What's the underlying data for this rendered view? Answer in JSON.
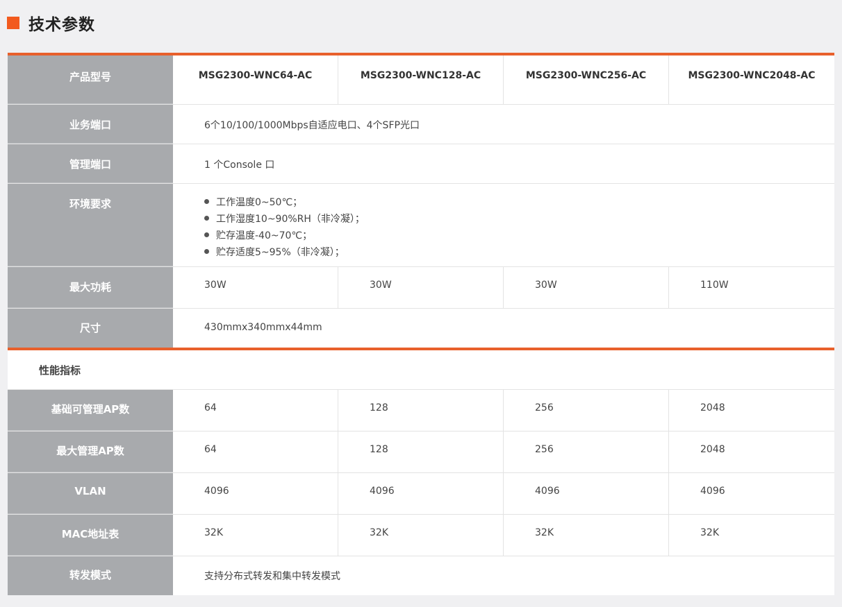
{
  "section_title": "技术参数",
  "models": [
    "MSG2300-WNC64-AC",
    "MSG2300-WNC128-AC",
    "MSG2300-WNC256-AC",
    "MSG2300-WNC2048-AC"
  ],
  "labels": {
    "model": "产品型号",
    "ports": "业务端口",
    "mgmt": "管理端口",
    "env": "环境要求",
    "power": "最大功耗",
    "size": "尺寸",
    "base_ap": "基础可管理AP数",
    "max_ap": "最大管理AP数",
    "vlan": "VLAN",
    "mac": "MAC地址表",
    "forward": "转发模式"
  },
  "values": {
    "ports": "6个10/100/1000Mbps自适应电口、4个SFP光口",
    "mgmt": "1 个Console 口",
    "env": [
      "工作温度0~50℃；",
      "工作湿度10~90%RH（非冷凝）；",
      "贮存温度-40~70℃；",
      "贮存适度5~95%（非冷凝）；"
    ],
    "power": [
      "30W",
      "30W",
      "30W",
      "110W"
    ],
    "size": "430mmx340mmx44mm",
    "base_ap": [
      "64",
      "128",
      "256",
      "2048"
    ],
    "max_ap": [
      "64",
      "128",
      "256",
      "2048"
    ],
    "vlan": [
      "4096",
      "4096",
      "4096",
      "4096"
    ],
    "mac": [
      "32K",
      "32K",
      "32K",
      "32K"
    ],
    "forward": "支持分布式转发和集中转发模式"
  },
  "performance_title": "性能指标",
  "colors": {
    "accent": "#e8602c",
    "label_bg": "#a8aaad"
  }
}
